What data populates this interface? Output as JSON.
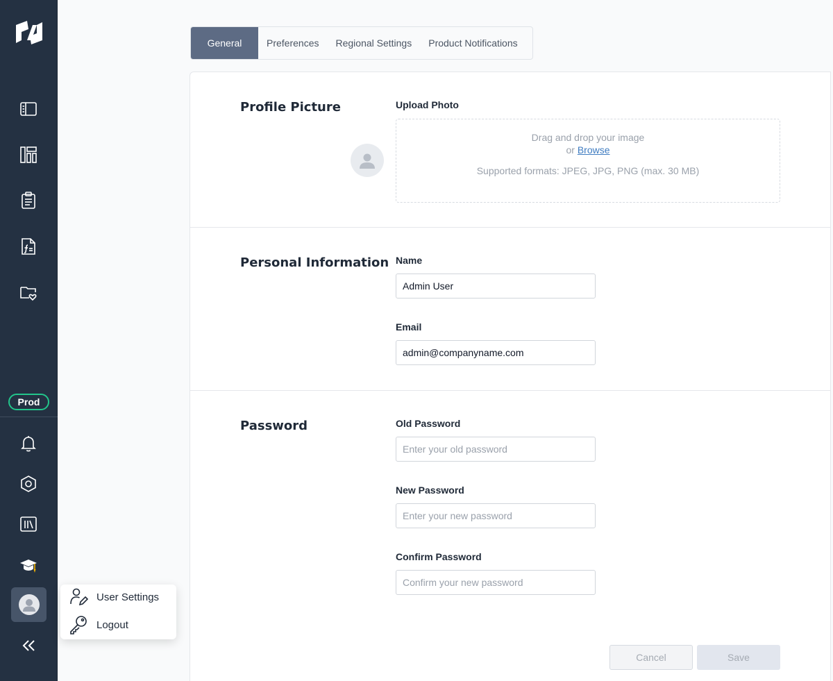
{
  "sidebar": {
    "logo": "company-logo",
    "nav": [
      {
        "icon": "book-open-icon"
      },
      {
        "icon": "dashboard-layout-icon"
      },
      {
        "icon": "clipboard-list-icon"
      },
      {
        "icon": "formula-document-icon"
      },
      {
        "icon": "folder-heart-icon"
      }
    ],
    "env_badge": "Prod",
    "bottom": [
      {
        "icon": "bell-icon"
      },
      {
        "icon": "hexagon-settings-icon"
      },
      {
        "icon": "library-icon"
      },
      {
        "icon": "graduation-cap-icon"
      }
    ],
    "collapse_label": "«"
  },
  "user_menu": {
    "items": [
      {
        "label": "User Settings",
        "icon": "user-edit-icon"
      },
      {
        "label": "Logout",
        "icon": "key-icon"
      }
    ]
  },
  "tabs": [
    {
      "label": "General",
      "active": true
    },
    {
      "label": "Preferences",
      "active": false
    },
    {
      "label": "Regional Settings",
      "active": false
    },
    {
      "label": "Product Notifications",
      "active": false
    }
  ],
  "profile": {
    "title": "Profile Picture",
    "upload_label": "Upload Photo",
    "drop_text": "Drag and drop your image",
    "or_text": "or",
    "browse_text": "Browse",
    "formats_text": "Supported formats: JPEG, JPG, PNG (max. 30 MB)"
  },
  "personal": {
    "title": "Personal Information",
    "name_label": "Name",
    "name_value": "Admin User",
    "email_label": "Email",
    "email_value": "admin@companyname.com"
  },
  "password": {
    "title": "Password",
    "old_label": "Old Password",
    "old_placeholder": "Enter your old password",
    "new_label": "New Password",
    "new_placeholder": "Enter your new password",
    "confirm_label": "Confirm Password",
    "confirm_placeholder": "Confirm your new password"
  },
  "actions": {
    "cancel_label": "Cancel",
    "save_label": "Save"
  },
  "colors": {
    "sidebar_bg": "#243142",
    "active_tab": "#5d6b84",
    "prod_badge_border": "#22c58b",
    "link": "#3f7cc1"
  }
}
